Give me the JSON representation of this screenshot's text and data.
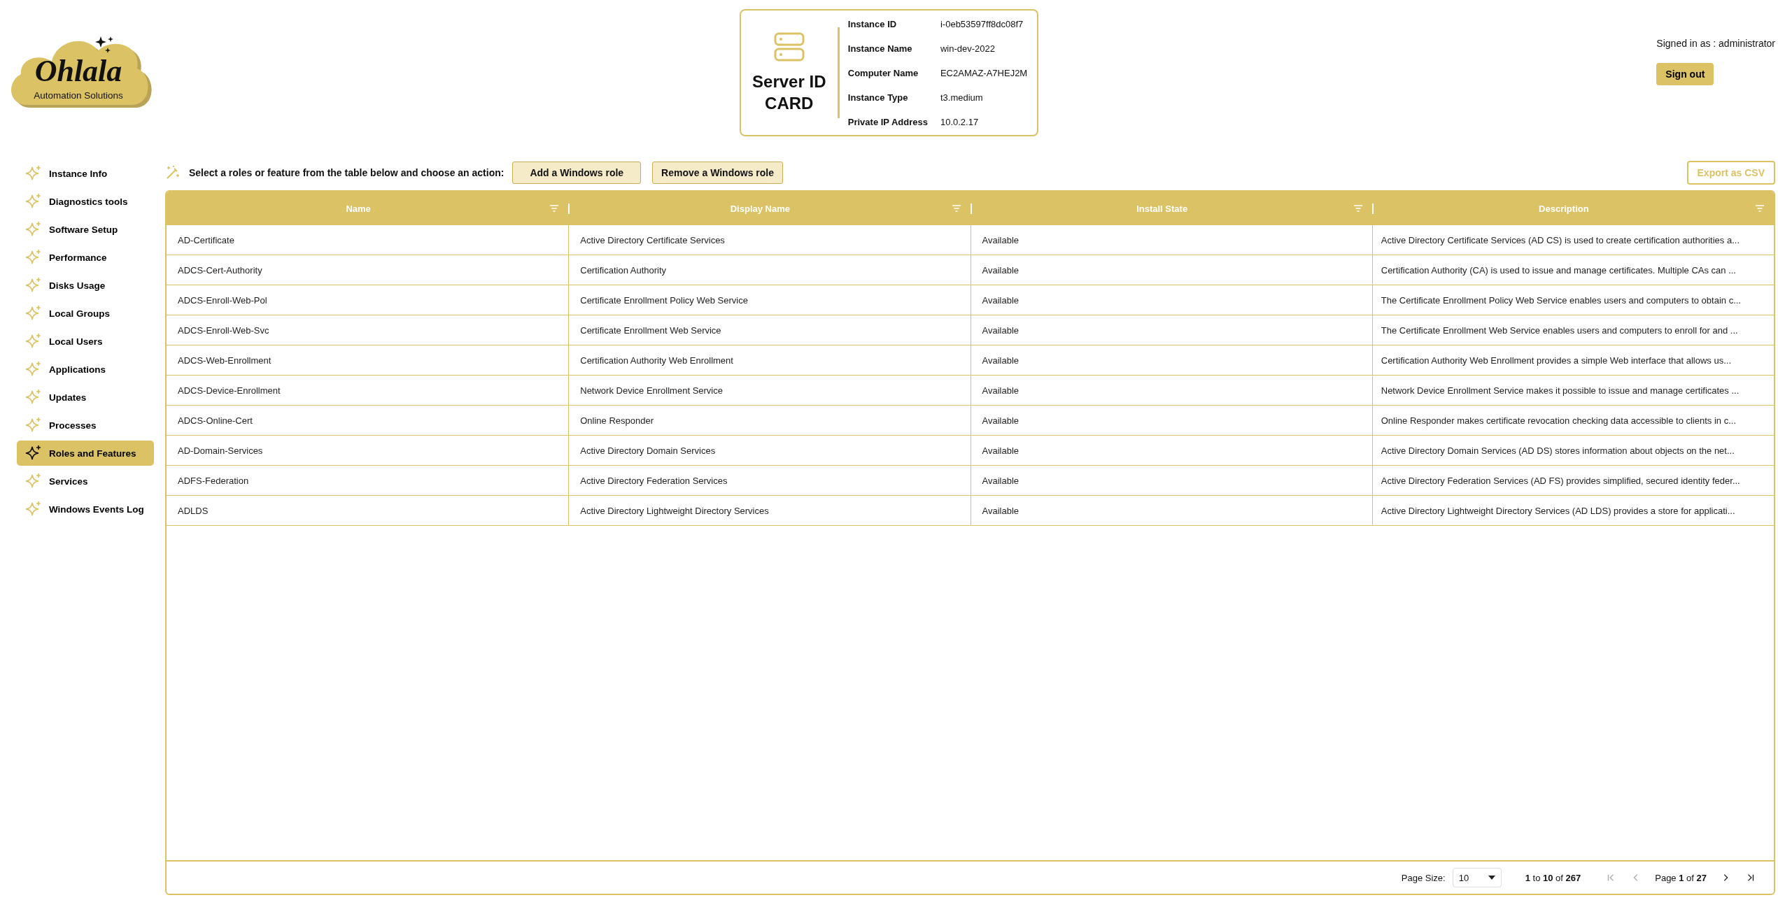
{
  "logo": {
    "title": "Ohlala",
    "subtitle": "Automation Solutions"
  },
  "server_card": {
    "title": "Server ID CARD",
    "fields": [
      {
        "label": "Instance ID",
        "value": "i-0eb53597ff8dc08f7"
      },
      {
        "label": "Instance Name",
        "value": "win-dev-2022"
      },
      {
        "label": "Computer Name",
        "value": "EC2AMAZ-A7HEJ2M"
      },
      {
        "label": "Instance Type",
        "value": "t3.medium"
      },
      {
        "label": "Private IP Address",
        "value": "10.0.2.17"
      }
    ]
  },
  "user": {
    "signed_in": "Signed in as : administrator",
    "sign_out": "Sign out"
  },
  "sidebar": {
    "items": [
      {
        "label": "Instance Info",
        "selected": false
      },
      {
        "label": "Diagnostics tools",
        "selected": false
      },
      {
        "label": "Software Setup",
        "selected": false
      },
      {
        "label": "Performance",
        "selected": false
      },
      {
        "label": "Disks Usage",
        "selected": false
      },
      {
        "label": "Local Groups",
        "selected": false
      },
      {
        "label": "Local Users",
        "selected": false
      },
      {
        "label": "Applications",
        "selected": false
      },
      {
        "label": "Updates",
        "selected": false
      },
      {
        "label": "Processes",
        "selected": false
      },
      {
        "label": "Roles and Features",
        "selected": true
      },
      {
        "label": "Services",
        "selected": false
      },
      {
        "label": "Windows Events Log",
        "selected": false
      }
    ]
  },
  "toolbar": {
    "prompt": "Select a roles or feature from the table below and choose an action:",
    "buttons": [
      "Add a Windows role",
      "Remove a Windows role"
    ],
    "export": {
      "label": "Export as CSV",
      "disabled": true
    }
  },
  "table": {
    "columns": [
      "Name",
      "Display Name",
      "Install State",
      "Description"
    ],
    "rows": [
      [
        "AD-Certificate",
        "Active Directory Certificate Services",
        "Available",
        "Active Directory Certificate Services (AD CS) is used to create certification authorities a..."
      ],
      [
        "ADCS-Cert-Authority",
        "Certification Authority",
        "Available",
        "Certification Authority (CA) is used to issue and manage certificates. Multiple CAs can ..."
      ],
      [
        "ADCS-Enroll-Web-Pol",
        "Certificate Enrollment Policy Web Service",
        "Available",
        "The Certificate Enrollment Policy Web Service enables users and computers to obtain c..."
      ],
      [
        "ADCS-Enroll-Web-Svc",
        "Certificate Enrollment Web Service",
        "Available",
        "The Certificate Enrollment Web Service enables users and computers to enroll for and ..."
      ],
      [
        "ADCS-Web-Enrollment",
        "Certification Authority Web Enrollment",
        "Available",
        "Certification Authority Web Enrollment provides a simple Web interface that allows us..."
      ],
      [
        "ADCS-Device-Enrollment",
        "Network Device Enrollment Service",
        "Available",
        "Network Device Enrollment Service makes it possible to issue and manage certificates ..."
      ],
      [
        "ADCS-Online-Cert",
        "Online Responder",
        "Available",
        "Online Responder makes certificate revocation checking data accessible to clients in c..."
      ],
      [
        "AD-Domain-Services",
        "Active Directory Domain Services",
        "Available",
        "Active Directory Domain Services (AD DS) stores information about objects on the net..."
      ],
      [
        "ADFS-Federation",
        "Active Directory Federation Services",
        "Available",
        "Active Directory Federation Services (AD FS) provides simplified, secured identity feder..."
      ],
      [
        "ADLDS",
        "Active Directory Lightweight Directory Services",
        "Available",
        "Active Directory Lightweight Directory Services (AD LDS) provides a store for applicati..."
      ]
    ]
  },
  "pagination": {
    "page_size_label": "Page Size:",
    "page_size": "10",
    "range": "**1** to **10** of **267**",
    "page": "Page **1** of **27**",
    "controls": [
      {
        "kind": "first",
        "disabled": true
      },
      {
        "kind": "prev",
        "disabled": true
      },
      {
        "kind": "next",
        "disabled": false
      },
      {
        "kind": "last",
        "disabled": false
      }
    ]
  }
}
